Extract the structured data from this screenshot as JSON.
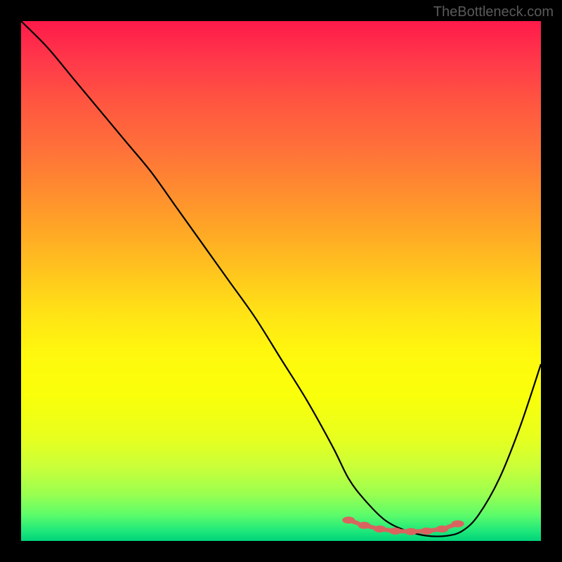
{
  "watermark": "TheBottleneck.com",
  "chart_data": {
    "type": "line",
    "title": "",
    "xlabel": "",
    "ylabel": "",
    "xlim": [
      0,
      100
    ],
    "ylim": [
      0,
      100
    ],
    "x": [
      0,
      5,
      10,
      15,
      20,
      25,
      30,
      35,
      40,
      45,
      50,
      55,
      60,
      63,
      66,
      70,
      74,
      78,
      82,
      85,
      88,
      92,
      96,
      100
    ],
    "values": [
      100,
      95,
      89,
      83,
      77,
      71,
      64,
      57,
      50,
      43,
      35,
      27,
      18,
      12,
      8,
      4,
      2,
      1,
      1,
      2,
      5,
      12,
      22,
      34
    ],
    "curve_note": "V-shaped bottleneck curve; minimum near x≈75-80",
    "markers": {
      "x": [
        63,
        66,
        69,
        72,
        75,
        78,
        81,
        84
      ],
      "values": [
        4.0,
        3.0,
        2.3,
        1.9,
        1.8,
        1.9,
        2.3,
        3.3
      ],
      "color": "#d9645f"
    },
    "background_gradient": {
      "top": "#ff1a4a",
      "mid": "#ffe216",
      "bottom": "#00d47a"
    }
  }
}
